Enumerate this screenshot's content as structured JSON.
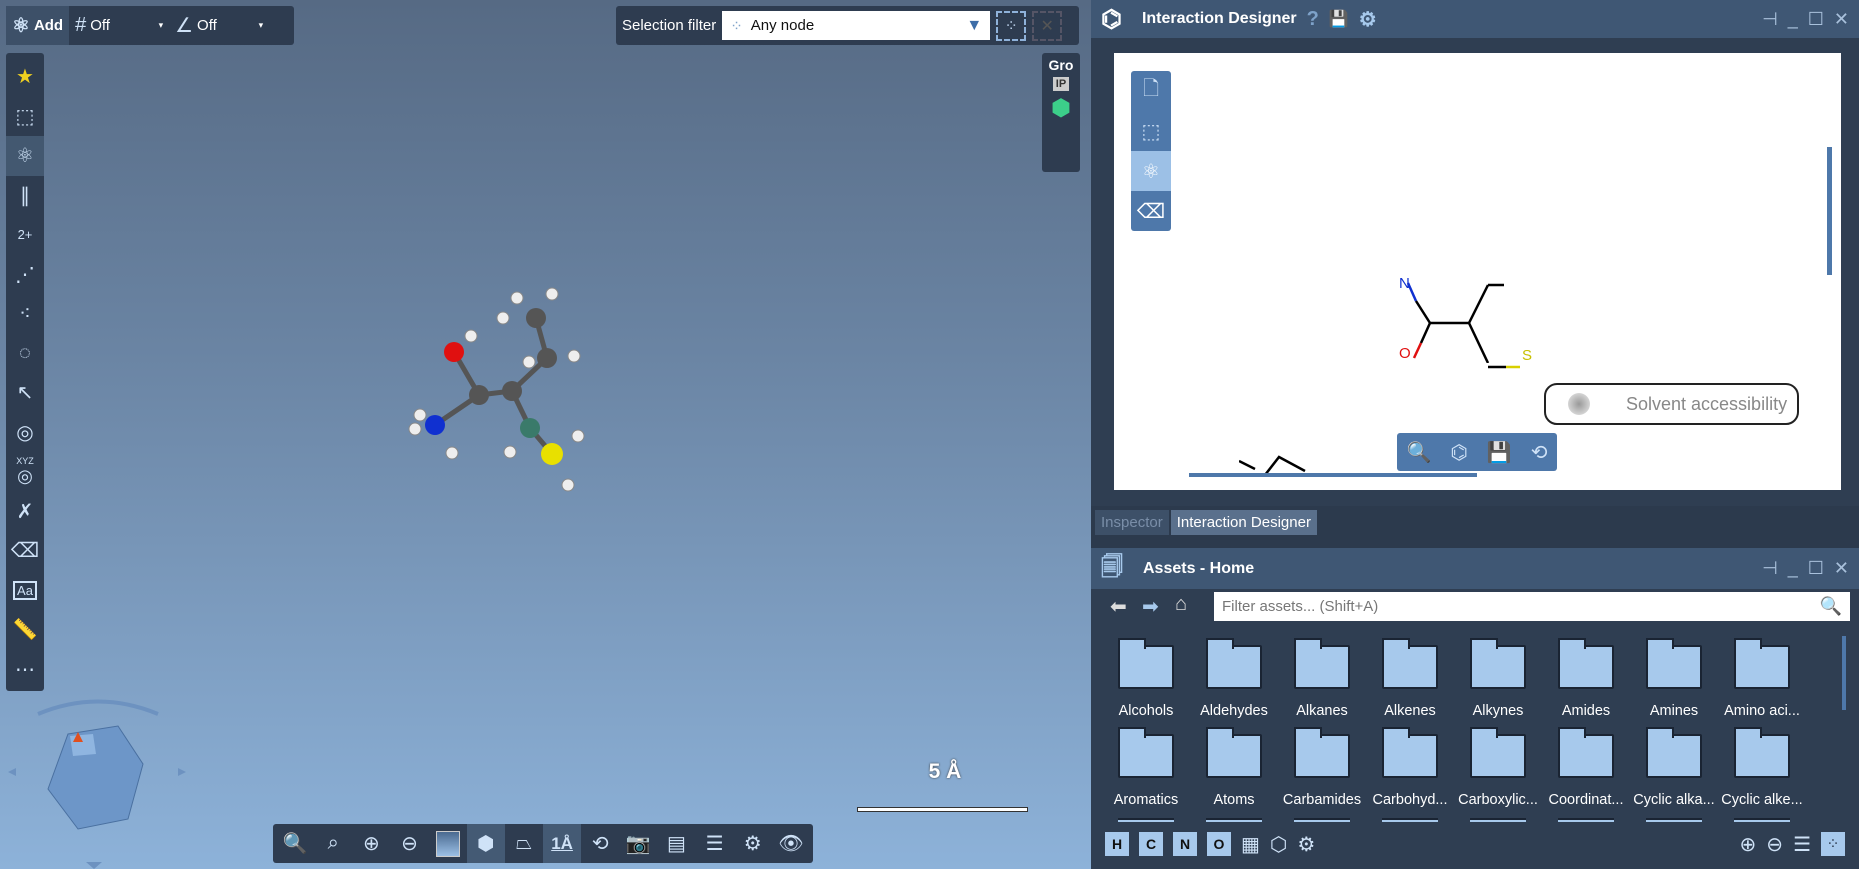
{
  "viewport": {
    "topbar": {
      "add_label": "Add",
      "grid_snap": "Off",
      "angle_snap": "Off"
    },
    "selection_filter": {
      "label": "Selection filter",
      "value": "Any node"
    },
    "right_tools": {
      "gro_label": "Gro",
      "ip_label": "IP"
    },
    "scale_label": "5 Å",
    "bottom_scale_label": "1Å",
    "left_tools": {
      "charge_label": "2+",
      "xyz_label": "XYZ",
      "text_label": "Aa"
    }
  },
  "interaction_designer": {
    "title": "Interaction Designer",
    "atoms": {
      "n": "N",
      "o": "O",
      "s": "S"
    },
    "legend": "Solvent accessibility"
  },
  "tabs": [
    {
      "label": "Inspector"
    },
    {
      "label": "Interaction Designer"
    }
  ],
  "assets": {
    "title": "Assets - Home",
    "filter_placeholder": "Filter assets... (Shift+A)",
    "folders": [
      "Alcohols",
      "Aldehydes",
      "Alkanes",
      "Alkenes",
      "Alkynes",
      "Amides",
      "Amines",
      "Amino aci...",
      "Aromatics",
      "Atoms",
      "Carbamides",
      "Carbohyd...",
      "Carboxylic...",
      "Coordinat...",
      "Cyclic alka...",
      "Cyclic alke..."
    ],
    "elements": [
      "H",
      "C",
      "N",
      "O"
    ]
  },
  "colors": {
    "nitrogen": "#1030d0",
    "oxygen": "#e01010",
    "sulfur": "#d8d000",
    "accent": "#4a78b0"
  }
}
